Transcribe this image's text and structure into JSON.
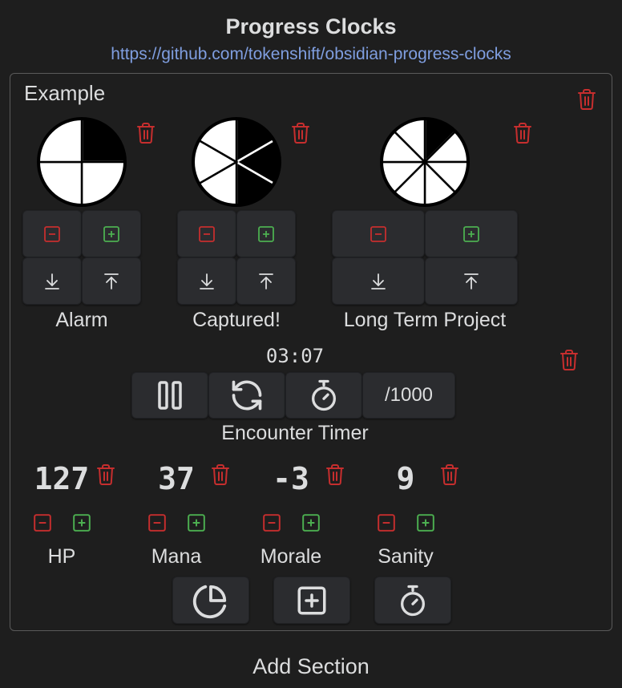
{
  "header": {
    "title": "Progress Clocks",
    "link": "https://github.com/tokenshift/obsidian-progress-clocks"
  },
  "section": {
    "name": "Example",
    "clocks": [
      {
        "name": "Alarm",
        "segments": 4,
        "filled": 1
      },
      {
        "name": "Captured!",
        "segments": 6,
        "filled": 3
      },
      {
        "name": "Long Term Project",
        "segments": 8,
        "filled": 1
      }
    ],
    "timer": {
      "name": "Encounter Timer",
      "time": "03:07",
      "rate_label": "/1000"
    },
    "counters": [
      {
        "name": "HP",
        "value": "127"
      },
      {
        "name": "Mana",
        "value": "37"
      },
      {
        "name": "Morale",
        "value": "-3"
      },
      {
        "name": "Sanity",
        "value": "9"
      }
    ]
  },
  "footer": {
    "add_section": "Add Section"
  },
  "colors": {
    "background": "#1e1e1e",
    "button": "#2b2c2f",
    "delete": "#c62e2e",
    "increment": "#4caf50",
    "decrement": "#c62e2e",
    "link": "#7f9ee0"
  },
  "icons": {
    "delete": "trash-icon",
    "decrement": "minus-square-icon",
    "increment": "plus-square-icon",
    "remove_segment": "arrow-down-to-line-icon",
    "add_segment": "arrow-up-from-line-icon",
    "pause": "pause-icon",
    "reset": "refresh-icon",
    "timer": "stopwatch-icon",
    "add_clock": "pie-chart-icon",
    "add_counter": "plus-square-icon",
    "add_timer": "stopwatch-icon"
  }
}
